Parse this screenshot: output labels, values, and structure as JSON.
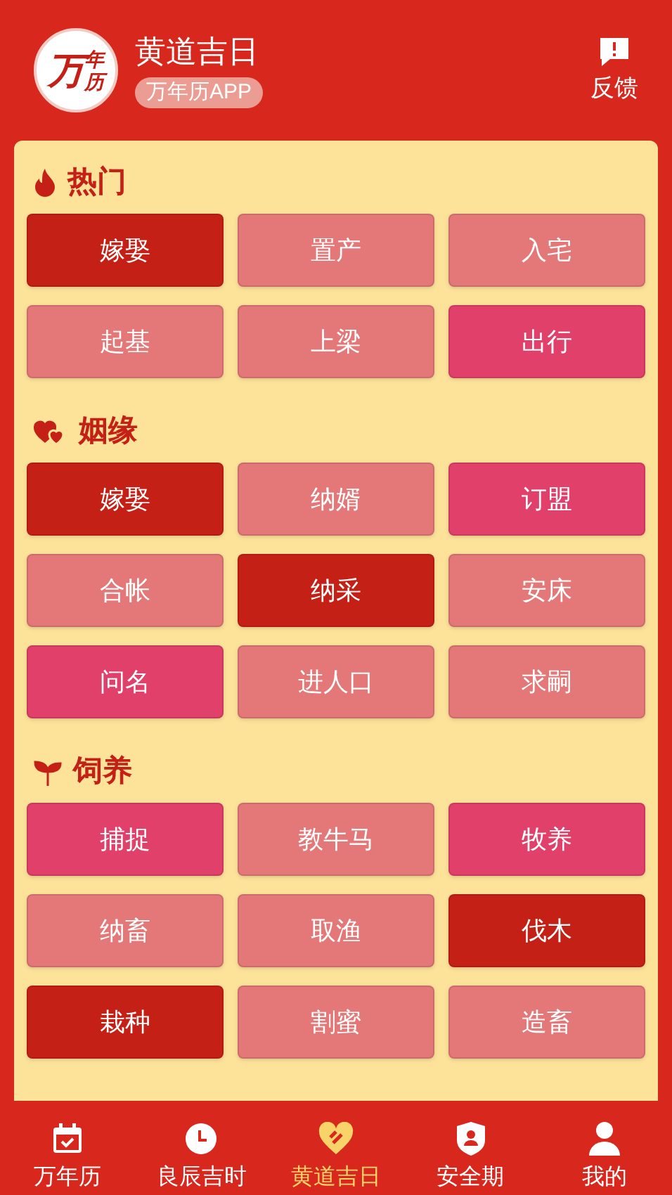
{
  "header": {
    "logo": {
      "big": "万",
      "small": "年历"
    },
    "title": "黄道吉日",
    "badge": "万年历APP",
    "feedback": "反馈"
  },
  "sections": [
    {
      "title": "热门",
      "items": [
        {
          "label": "嫁娶",
          "color": "#c42016"
        },
        {
          "label": "置产",
          "color": "#e47878"
        },
        {
          "label": "入宅",
          "color": "#e47878"
        },
        {
          "label": "起基",
          "color": "#e47878"
        },
        {
          "label": "上梁",
          "color": "#e47878"
        },
        {
          "label": "出行",
          "color": "#e0406a"
        }
      ]
    },
    {
      "title": "姻缘",
      "items": [
        {
          "label": "嫁娶",
          "color": "#c42016"
        },
        {
          "label": "纳婿",
          "color": "#e47878"
        },
        {
          "label": "订盟",
          "color": "#e0406a"
        },
        {
          "label": "合帐",
          "color": "#e47878"
        },
        {
          "label": "纳采",
          "color": "#c42016"
        },
        {
          "label": "安床",
          "color": "#e47878"
        },
        {
          "label": "问名",
          "color": "#e0406a"
        },
        {
          "label": "进人口",
          "color": "#e47878"
        },
        {
          "label": "求嗣",
          "color": "#e47878"
        }
      ]
    },
    {
      "title": "饲养",
      "items": [
        {
          "label": "捕捉",
          "color": "#e0406a"
        },
        {
          "label": "教牛马",
          "color": "#e47878"
        },
        {
          "label": "牧养",
          "color": "#e0406a"
        },
        {
          "label": "纳畜",
          "color": "#e47878"
        },
        {
          "label": "取渔",
          "color": "#e47878"
        },
        {
          "label": "伐木",
          "color": "#c42016"
        },
        {
          "label": "栽种",
          "color": "#c42016"
        },
        {
          "label": "割蜜",
          "color": "#e47878"
        },
        {
          "label": "造畜",
          "color": "#e47878"
        }
      ]
    }
  ],
  "nav": [
    {
      "label": "万年历",
      "selected": false
    },
    {
      "label": "良辰吉时",
      "selected": false
    },
    {
      "label": "黄道吉日",
      "selected": true
    },
    {
      "label": "安全期",
      "selected": false
    },
    {
      "label": "我的",
      "selected": false
    }
  ]
}
